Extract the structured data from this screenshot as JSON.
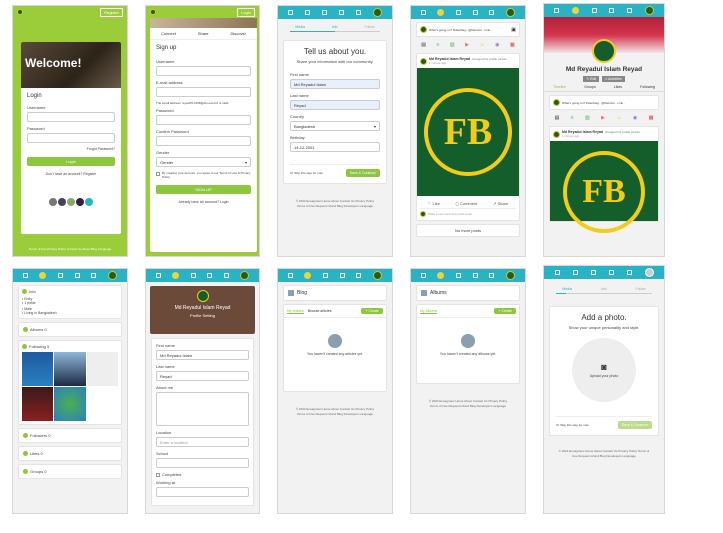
{
  "login": {
    "register_btn": "Register",
    "welcome": "Welcome!",
    "login_title": "Login",
    "username_label": "Username",
    "password_label": "Password",
    "forgot": "Forgot Password?",
    "login_btn": "Login",
    "no_account": "Don't have an account? Register",
    "footer": "Terms of Use  Privacy Policy  Contact Us  About  Blog  Language"
  },
  "signup": {
    "login_btn": "Login",
    "tabs": [
      "Connect",
      "Share",
      "Discover"
    ],
    "title": "Sign up",
    "username": "Username",
    "email": "E-mail address",
    "email_note": "The email address 'reyad15-4158@diu.edu.bd' is valid.",
    "password": "Password",
    "confirm": "Confirm Password",
    "gender": "Gender",
    "gender_opt": "Gender",
    "terms": "By creating your account, you agree to our Terms of Use & Privacy Policy",
    "signup_btn": "SIGN UP",
    "have_account": "Already have an account? Login"
  },
  "tell": {
    "steps": [
      "Media",
      "Info",
      "Follow"
    ],
    "title": "Tell us about you.",
    "subtitle": "Share your information with our community.",
    "first_label": "First name",
    "first_val": "Md Reyadul Islam",
    "last_label": "Last name",
    "last_val": "Reyad",
    "country_label": "Country",
    "country_val": "Bangladesh",
    "birthday_label": "Birthday",
    "birthday_val": "14-12-2001",
    "skip": "Or Skip this step for now",
    "save_btn": "Save & Continue",
    "footer": "© 2024 Ecoagrotec  Home  About  Contact Us  Privacy Policy  Terms of Use  Request refund  Blog  Developers  Language"
  },
  "feed": {
    "compose": "What's going on? #Hashtag.. @Mention.. Link..",
    "poster": "Md Reyadul Islam Reyad",
    "action": "changed his profile picture",
    "time": "1 minute ago",
    "like": "Like",
    "comment": "Comment",
    "share": "Share",
    "comment_ph": "Write a comment and press enter",
    "no_more": "No more posts"
  },
  "profile": {
    "name": "Md Reyadul Islam Reyad",
    "edit": "Edit",
    "activities": "Activities",
    "tabs": [
      "Timeline",
      "Groups",
      "Likes",
      "Following"
    ],
    "compose": "What's going on? #Hashtag.. @Mention.. Link..",
    "poster": "Md Reyadul Islam Reyad",
    "action": "changed his profile picture",
    "time": "1 minute ago"
  },
  "about": {
    "info": "Info",
    "items": [
      "Entry",
      "1 posts",
      "Male",
      "Living in Bangladesh"
    ],
    "albums": "Albums 0",
    "following": "Following 5",
    "followers": "Followers 0",
    "likes": "Likes 0",
    "groups": "Groups 0"
  },
  "setting": {
    "name": "Md Reyadul Islam Reyad",
    "subtitle": "Profile Setting",
    "first_label": "First name",
    "first_val": "Md Reyadul Islam",
    "last_label": "Last name",
    "last_val": "Reyad",
    "about_label": "About me",
    "location_label": "Location",
    "location_ph": "Enter a location",
    "school_label": "School",
    "completed": "Completed",
    "working_label": "Working at"
  },
  "blog": {
    "title": "Blog",
    "tab1": "My articles",
    "tab2": "Browse articles",
    "create": "+ Create",
    "empty": "You haven't created any articles yet.",
    "footer": "© 2024 Ecoagrotec  Home  About  Contact Us  Privacy Policy  Terms of Use  Request refund  Blog  Developers  Language"
  },
  "albums": {
    "title": "Albums",
    "tab1": "My Albums",
    "create": "+ Create",
    "empty": "You haven't created any albums yet.",
    "footer": "© 2024 Ecoagrotec  Home  About  Contact Us  Privacy Policy  Terms of Use  Request refund  Blog  Developers  Language"
  },
  "photo": {
    "steps": [
      "Media",
      "Info",
      "Follow"
    ],
    "title": "Add a photo.",
    "subtitle": "Show your unique personality and style.",
    "upload": "Upload your photo",
    "skip": "Or Skip this step for now",
    "save_btn": "Save & Continue",
    "footer": "© 2024 Ecoagrotec  Home  About  Contact Us  Privacy Policy  Terms of Use  Request refund  Blog  Developers  Language"
  },
  "colors": {
    "accent": "#2ab3c5",
    "green": "#8dc63f",
    "logo": "#135e2a",
    "gold": "#f3cc1a"
  }
}
